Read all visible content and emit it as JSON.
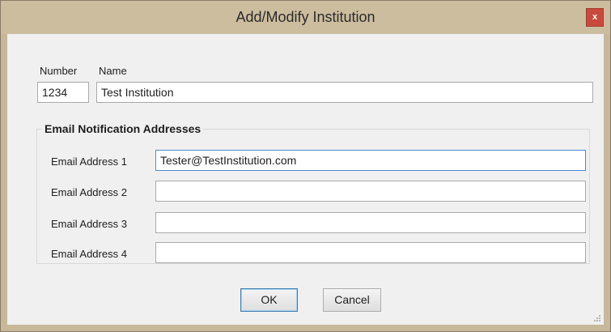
{
  "window": {
    "title": "Add/Modify Institution",
    "close_glyph": "x"
  },
  "form": {
    "number_label": "Number",
    "name_label": "Name",
    "number_value": "1234",
    "name_value": "Test Institution"
  },
  "email_group": {
    "title": "Email Notification Addresses",
    "fields": [
      {
        "label": "Email Address 1",
        "value": "Tester@TestInstitution.com"
      },
      {
        "label": "Email Address 2",
        "value": ""
      },
      {
        "label": "Email Address 3",
        "value": ""
      },
      {
        "label": "Email Address 4",
        "value": ""
      }
    ]
  },
  "buttons": {
    "ok_label": "OK",
    "cancel_label": "Cancel"
  },
  "colors": {
    "frame": "#c8b89a",
    "client": "#f0f0f0",
    "close_button": "#c74a3c",
    "focus_border": "#4f8ad2"
  },
  "icons": {
    "close": "close-icon",
    "resize": "resize-grip-icon"
  }
}
